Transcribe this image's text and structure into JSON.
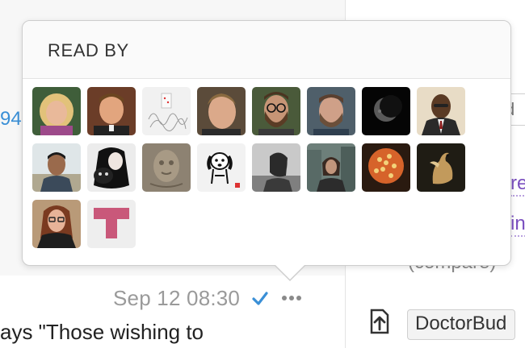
{
  "background": {
    "left_edge_number": "94",
    "message": {
      "timestamp": "Sep 12 08:30",
      "read_icon": "checkmark-icon",
      "more_icon": "ellipsis-icon",
      "text_fragment": "ays \"Those wishing to"
    },
    "right_panel": {
      "box_fragment": "d",
      "link_fragment_1": "re",
      "link_fragment_2": "in",
      "compare_fragment": "(compare)",
      "upload_icon": "upload-icon",
      "user_chip": "DoctorBud"
    }
  },
  "popover": {
    "title": "READ BY",
    "readers": [
      {
        "icon": "avatar-blonde-woman"
      },
      {
        "icon": "avatar-smiling-man"
      },
      {
        "icon": "avatar-sketch-drawing"
      },
      {
        "icon": "avatar-young-man"
      },
      {
        "icon": "avatar-bearded-man-glasses"
      },
      {
        "icon": "avatar-bearded-man"
      },
      {
        "icon": "avatar-moon"
      },
      {
        "icon": "avatar-man-in-suit"
      },
      {
        "icon": "avatar-man-outdoors"
      },
      {
        "icon": "avatar-woman-with-cat"
      },
      {
        "icon": "avatar-stone-carving"
      },
      {
        "icon": "avatar-cartoon-dog"
      },
      {
        "icon": "avatar-woman-profile"
      },
      {
        "icon": "avatar-woman-in-city"
      },
      {
        "icon": "avatar-orange-sphere"
      },
      {
        "icon": "avatar-bird-sculpture"
      },
      {
        "icon": "avatar-woman-glasses"
      },
      {
        "icon": "avatar-pink-t-logo"
      }
    ]
  },
  "colors": {
    "accent_blue": "#3a8fd6",
    "link_purple": "#7a4fbf",
    "popover_border": "#cdcdcd"
  }
}
